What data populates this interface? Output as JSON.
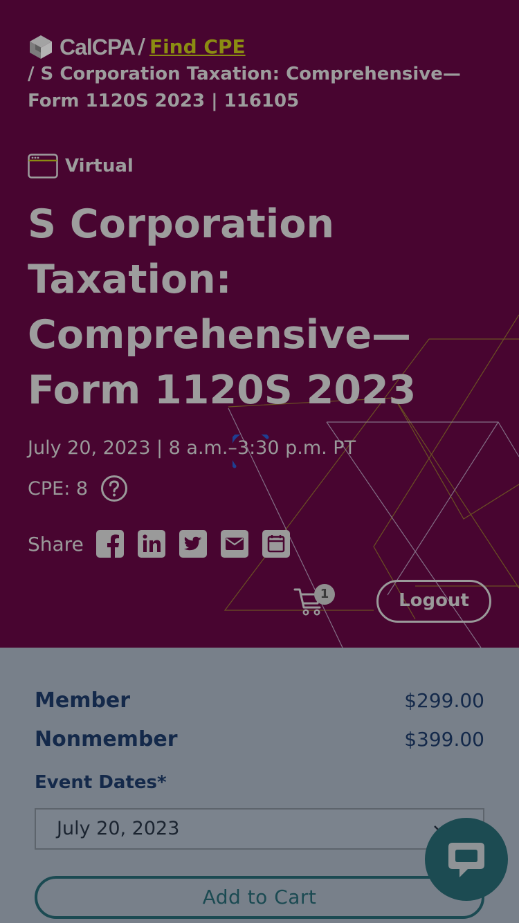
{
  "breadcrumb": {
    "brand": "CalCPA",
    "separator": "/",
    "find_cpe": "Find CPE",
    "current": "/ S Corporation Taxation: Comprehensive— Form 1120S 2023 | 116105"
  },
  "event": {
    "format_label": "Virtual",
    "title": "S Corporation Taxation: Comprehensive— Form 1120S 2023",
    "date_time": "July 20, 2023 | 8 a.m.–3:30 p.m. PT",
    "cpe": "CPE: 8"
  },
  "share": {
    "label": "Share",
    "icons": [
      "facebook-icon",
      "linkedin-icon",
      "twitter-icon",
      "email-icon",
      "calendar-icon"
    ]
  },
  "header_actions": {
    "cart_count": "1",
    "logout_label": "Logout"
  },
  "pricing": {
    "member_label": "Member",
    "member_price": "$299.00",
    "nonmember_label": "Nonmember",
    "nonmember_price": "$399.00"
  },
  "event_dates": {
    "label": "Event Dates*",
    "selected": "July 20, 2023"
  },
  "cart_button": {
    "label": "Add to Cart"
  },
  "colors": {
    "hero_bg": "#480530",
    "link": "#8b8c12",
    "navy": "#14294a",
    "teal": "#1b4a52",
    "overlay_bg": "#78808a"
  }
}
